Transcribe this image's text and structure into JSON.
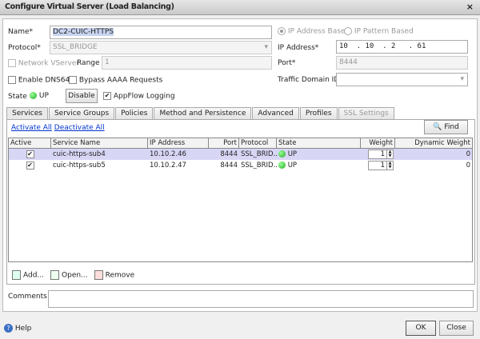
{
  "window": {
    "title": "Configure Virtual Server (Load Balancing)",
    "close": "×"
  },
  "form": {
    "name_label": "Name*",
    "name_value": "DC2-CUIC-HTTPS",
    "protocol_label": "Protocol*",
    "protocol_value": "SSL_BRIDGE",
    "network_vserver_label": "Network VServer",
    "range_label": "Range",
    "range_value": "1",
    "enable_dns64_label": "Enable DNS64",
    "bypass_aaaa_label": "Bypass AAAA Requests",
    "state_label": "State",
    "state_value": "UP",
    "disable_button": "Disable",
    "appflow_label": "AppFlow Logging",
    "ip_address_based": "IP Address Based",
    "ip_pattern_based": "IP Pattern Based",
    "ip_address_label": "IP Address*",
    "ip_address_value": "10  . 10  . 2   . 61",
    "port_label": "Port*",
    "port_value": "8444",
    "traffic_domain_label": "Traffic Domain ID",
    "traffic_domain_value": ""
  },
  "tabs": [
    "Services",
    "Service Groups",
    "Policies",
    "Method and Persistence",
    "Advanced",
    "Profiles",
    "SSL Settings"
  ],
  "services": {
    "activate_all": "Activate All",
    "deactivate_all": "Deactivate All",
    "find": "Find",
    "columns": [
      "Active",
      "Service Name",
      "IP Address",
      "Port",
      "Protocol",
      "State",
      "Weight",
      "Dynamic Weight"
    ],
    "rows": [
      {
        "active": "✔",
        "name": "cuic-https-sub4",
        "ip": "10.10.2.46",
        "port": "8444",
        "protocol": "SSL_BRID...",
        "state": "UP",
        "weight": "1",
        "dynamic_weight": "0"
      },
      {
        "active": "✔",
        "name": "cuic-https-sub5",
        "ip": "10.10.2.47",
        "port": "8444",
        "protocol": "SSL_BRID...",
        "state": "UP",
        "weight": "1",
        "dynamic_weight": "0"
      }
    ],
    "add": "Add...",
    "open": "Open...",
    "remove": "Remove"
  },
  "comments_label": "Comments",
  "comments_value": "",
  "footer": {
    "help": "Help",
    "ok": "OK",
    "close": "Close"
  }
}
